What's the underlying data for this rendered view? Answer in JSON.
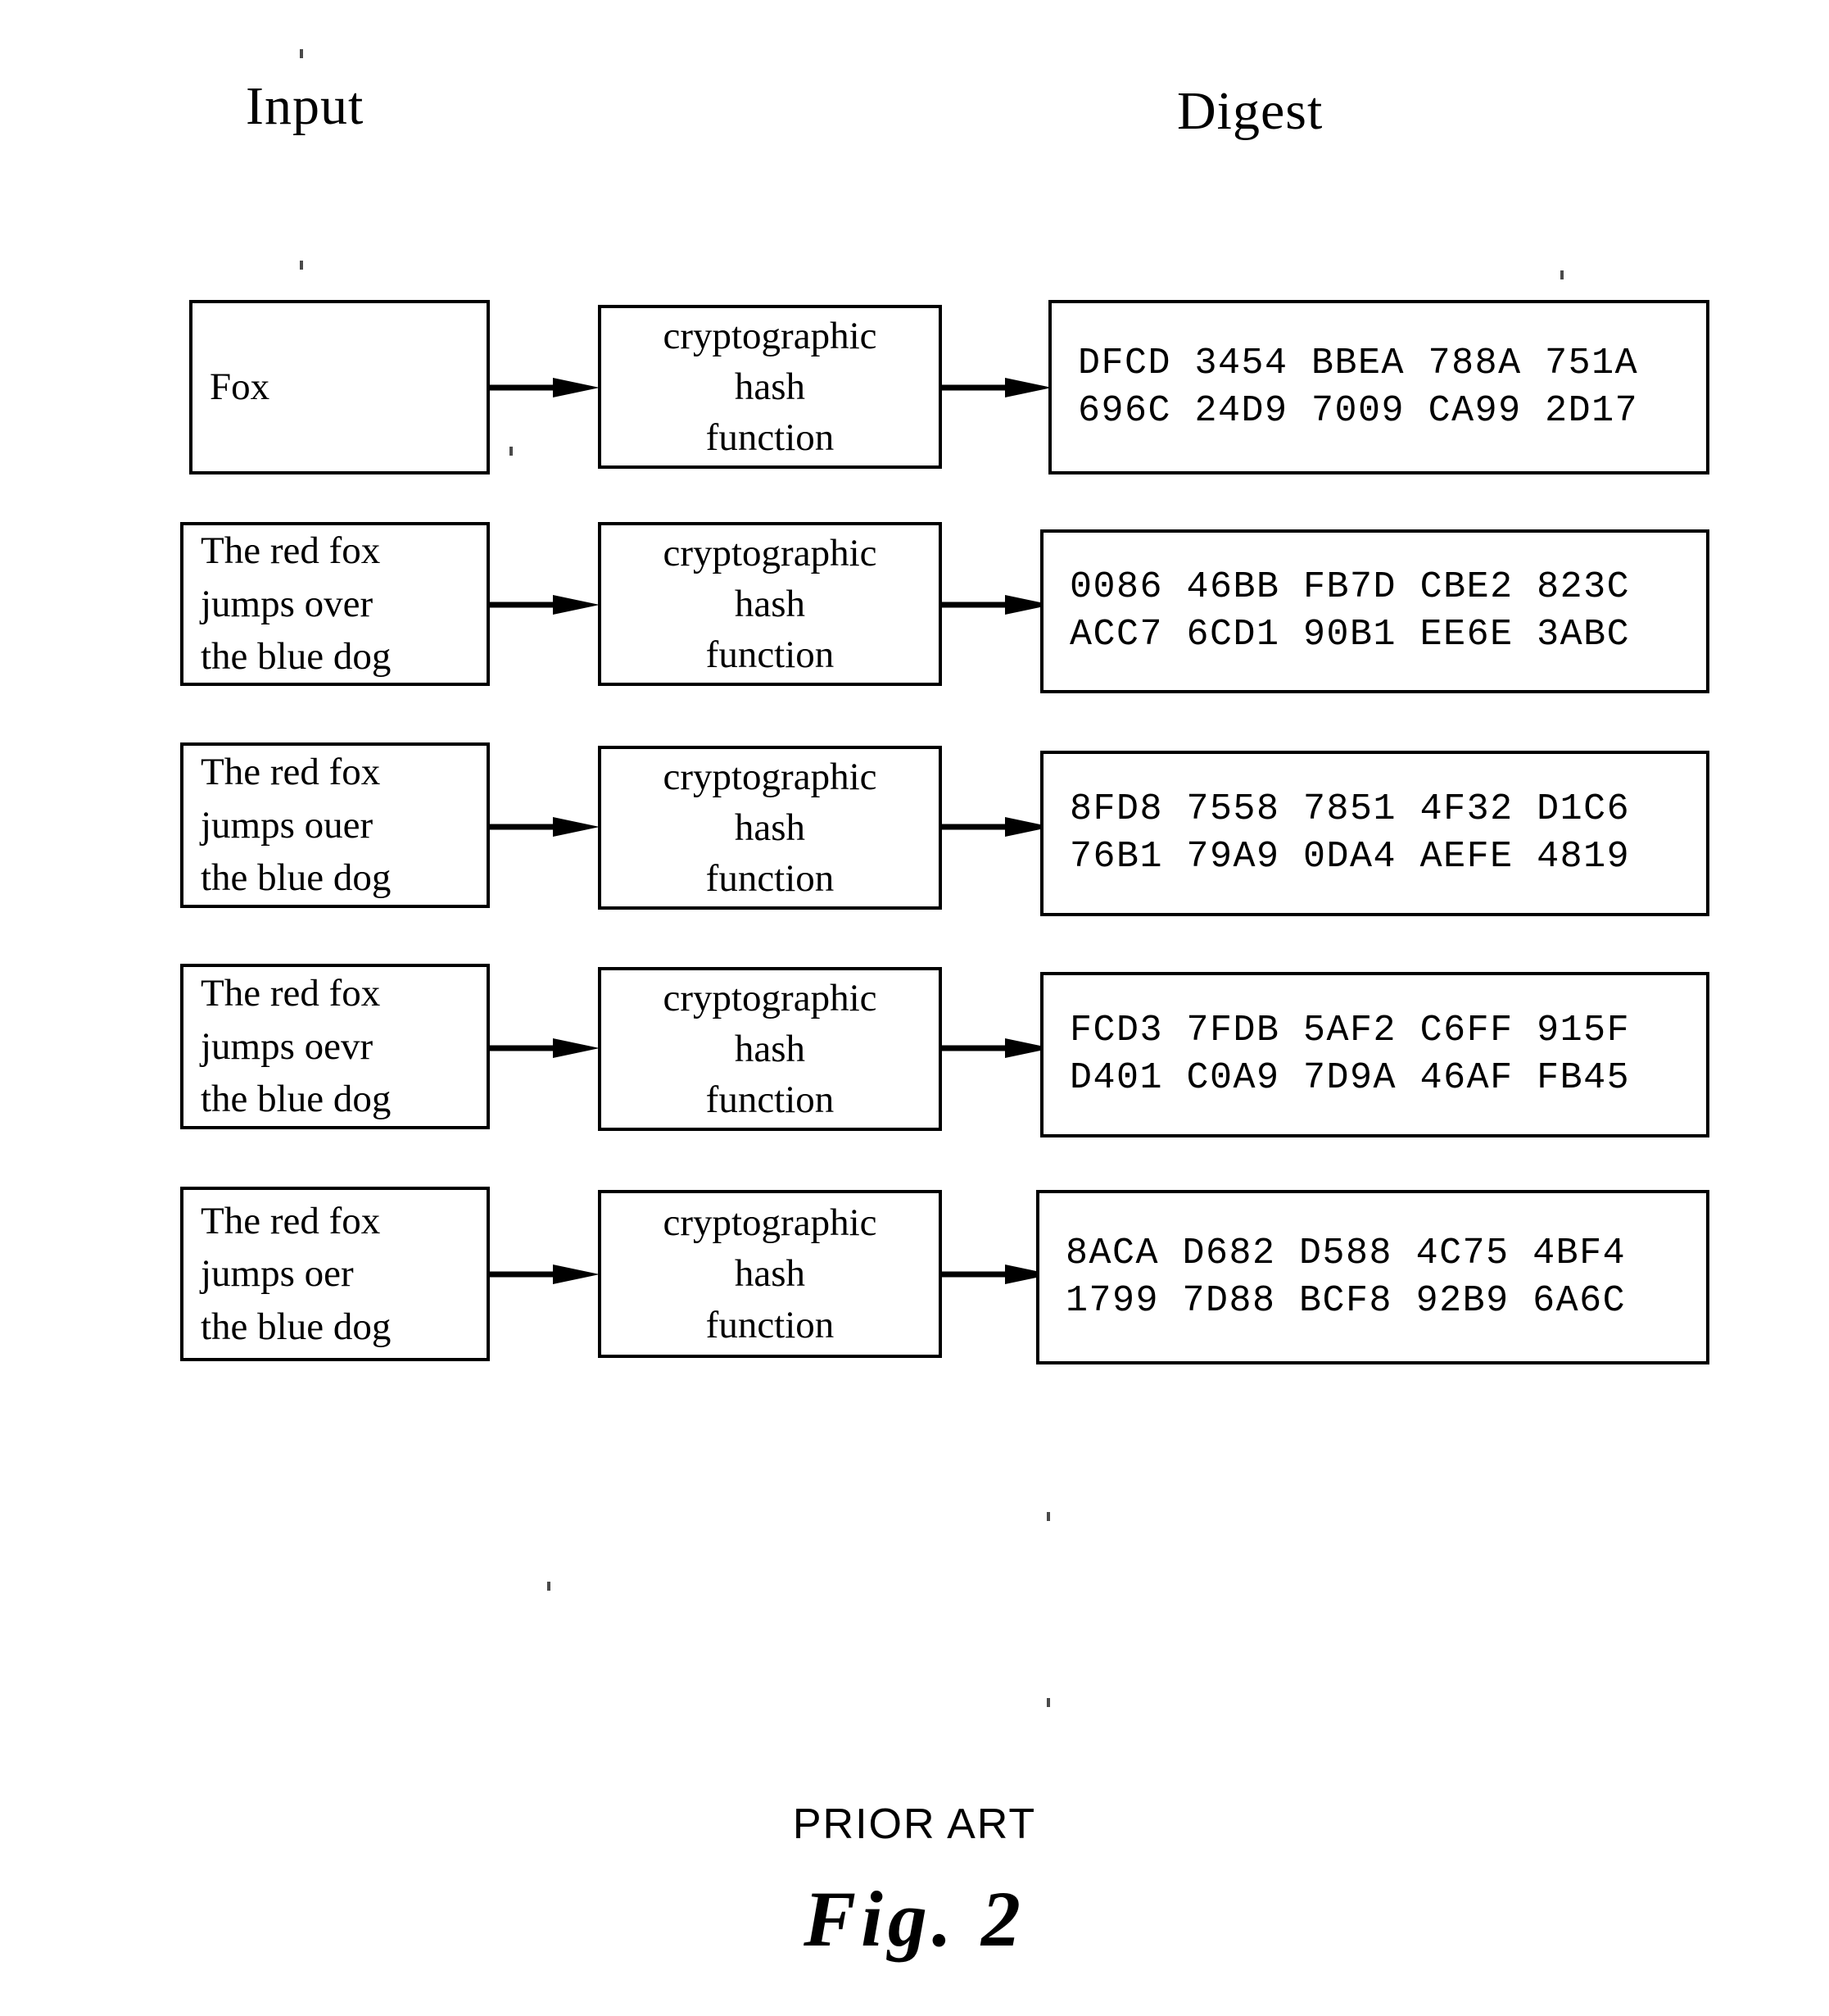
{
  "headers": {
    "input": "Input",
    "digest": "Digest"
  },
  "hash_box_label": "cryptographic\nhash\nfunction",
  "rows": [
    {
      "input": "Fox",
      "digest": "DFCD  3454  BBEA  788A  751A\n696C  24D9  7009  CA99  2D17"
    },
    {
      "input": "The red fox\njumps over\nthe blue dog",
      "digest": "0086  46BB  FB7D  CBE2  823C\nACC7  6CD1  90B1  EE6E  3ABC"
    },
    {
      "input": "The red fox\njumps ouer\nthe blue dog",
      "digest": "8FD8  7558  7851  4F32  D1C6\n76B1  79A9  0DA4  AEFE  4819"
    },
    {
      "input": "The red fox\njumps oevr\nthe blue dog",
      "digest": "FCD3  7FDB  5AF2  C6FF  915F\nD401  C0A9  7D9A  46AF  FB45"
    },
    {
      "input": "The red fox\njumps oer\nthe blue dog",
      "digest": "8ACA  D682  D588  4C75  4BF4\n1799  7D88  BCF8  92B9  6A6C"
    }
  ],
  "caption": {
    "prior_art": "PRIOR ART",
    "figure": "Fig.  2"
  },
  "colors": {
    "ink": "#000000",
    "paper": "#ffffff"
  }
}
